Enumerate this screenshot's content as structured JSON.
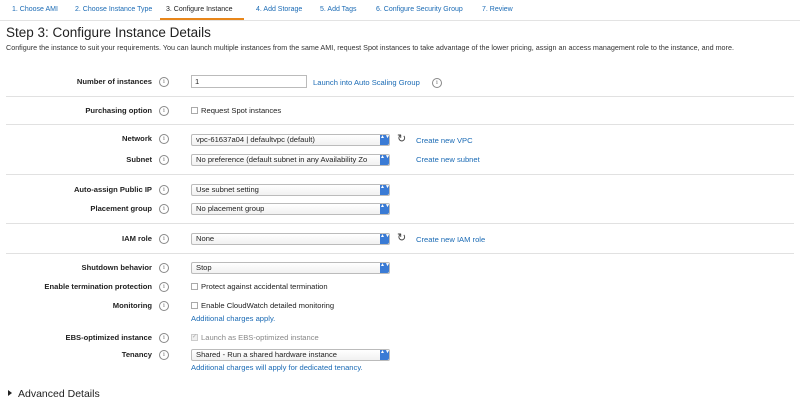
{
  "wizard": {
    "steps": [
      "1. Choose AMI",
      "2. Choose Instance Type",
      "3. Configure Instance",
      "4. Add Storage",
      "5. Add Tags",
      "6. Configure Security Group",
      "7. Review"
    ],
    "active_step": 2
  },
  "page": {
    "title": "Step 3: Configure Instance Details",
    "intro": "Configure the instance to suit your requirements. You can launch multiple instances from the same AMI, request Spot instances to take advantage of the lower pricing, assign an access management role to the instance, and more."
  },
  "info_glyph": "i",
  "refresh_glyph": "↻",
  "arrow_glyph": "▲▼",
  "check_glyph": "✓",
  "fields": {
    "instances": {
      "label": "Number of instances",
      "value": "1",
      "link": "Launch into Auto Scaling Group"
    },
    "purchasing": {
      "label": "Purchasing option",
      "checkbox": "Request Spot instances",
      "checked": false
    },
    "network": {
      "label": "Network",
      "value": "vpc-61637a04 | defaultvpc (default)",
      "link": "Create new VPC"
    },
    "subnet": {
      "label": "Subnet",
      "value": "No preference (default subnet in any Availability Zo",
      "link": "Create new subnet"
    },
    "public_ip": {
      "label": "Auto-assign Public IP",
      "value": "Use subnet setting"
    },
    "placement": {
      "label": "Placement group",
      "value": "No placement group"
    },
    "iam": {
      "label": "IAM role",
      "value": "None",
      "link": "Create new IAM role"
    },
    "shutdown": {
      "label": "Shutdown behavior",
      "value": "Stop"
    },
    "termination": {
      "label": "Enable termination protection",
      "checkbox": "Protect against accidental termination",
      "checked": false
    },
    "monitoring": {
      "label": "Monitoring",
      "checkbox": "Enable CloudWatch detailed monitoring",
      "checked": false,
      "link": "Additional charges apply."
    },
    "ebs": {
      "label": "EBS-optimized instance",
      "checkbox": "Launch as EBS-optimized instance",
      "checked": true,
      "disabled": true
    },
    "tenancy": {
      "label": "Tenancy",
      "value": "Shared - Run a shared hardware instance",
      "link": "Additional charges will apply for dedicated tenancy."
    }
  },
  "advanced": {
    "label": "Advanced Details"
  },
  "colors": {
    "link": "#1b6bb5",
    "tab_active_underline": "#e8861a",
    "select_arrow": "#3a7bd5"
  }
}
